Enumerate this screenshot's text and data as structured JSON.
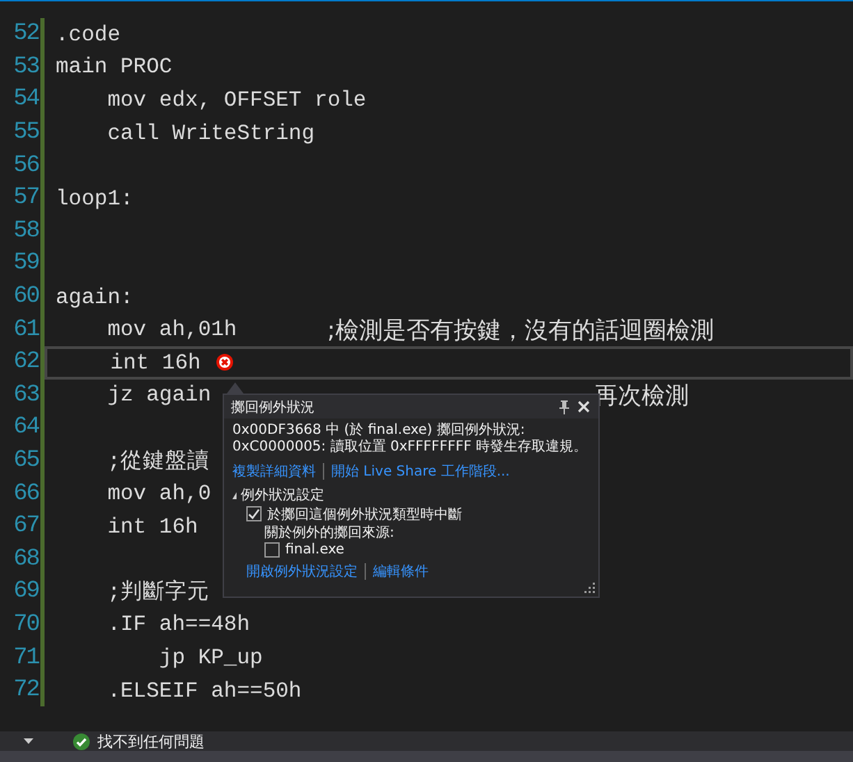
{
  "editor": {
    "lines": [
      {
        "number": "52",
        "code": ".code"
      },
      {
        "number": "53",
        "code": "main PROC"
      },
      {
        "number": "54",
        "code": "    mov edx, OFFSET role"
      },
      {
        "number": "55",
        "code": "    call WriteString"
      },
      {
        "number": "56"
      },
      {
        "number": "57",
        "code": "loop1:"
      },
      {
        "number": "58"
      },
      {
        "number": "59"
      },
      {
        "number": "60",
        "code": "again:"
      },
      {
        "number": "61",
        "code": "    mov ah,01h",
        "comment": ";檢測是否有按鍵，沒有的話迴圈檢測"
      },
      {
        "number": "62",
        "code": "    int 16h",
        "current": true,
        "error": true
      },
      {
        "number": "63",
        "code": "    jz again",
        "comment": "再次檢測",
        "kind": "covered"
      },
      {
        "number": "64"
      },
      {
        "number": "65",
        "code": "    ;從鍵盤讀"
      },
      {
        "number": "66",
        "code": "    mov ah,0"
      },
      {
        "number": "67",
        "code": "    int 16h"
      },
      {
        "number": "68"
      },
      {
        "number": "69",
        "code": "    ;判斷字元"
      },
      {
        "number": "70",
        "code": "    .IF ah==48h"
      },
      {
        "number": "71",
        "code": "        jp KP_up"
      },
      {
        "number": "72",
        "code": "    .ELSEIF ah==50h"
      }
    ]
  },
  "exception_popup": {
    "title": "擲回例外狀況",
    "message": "0x00DF3668 中 (於 final.exe) 擲回例外狀況: 0xC0000005: 讀取位置 0xFFFFFFFF 時發生存取違規。",
    "links": [
      "複製詳細資料",
      "開始 Live Share 工作階段..."
    ],
    "settings": {
      "title": "例外狀況設定",
      "expanded": true,
      "break_option": {
        "label": "於擲回這個例外狀況類型時中斷",
        "checked": true
      },
      "source_label": "關於例外的擲回來源:",
      "sources": [
        {
          "label": "final.exe",
          "checked": false
        }
      ]
    },
    "footer_links": [
      "開啟例外狀況設定",
      "編輯條件"
    ]
  },
  "status_bar": {
    "message": "找不到任何問題"
  }
}
